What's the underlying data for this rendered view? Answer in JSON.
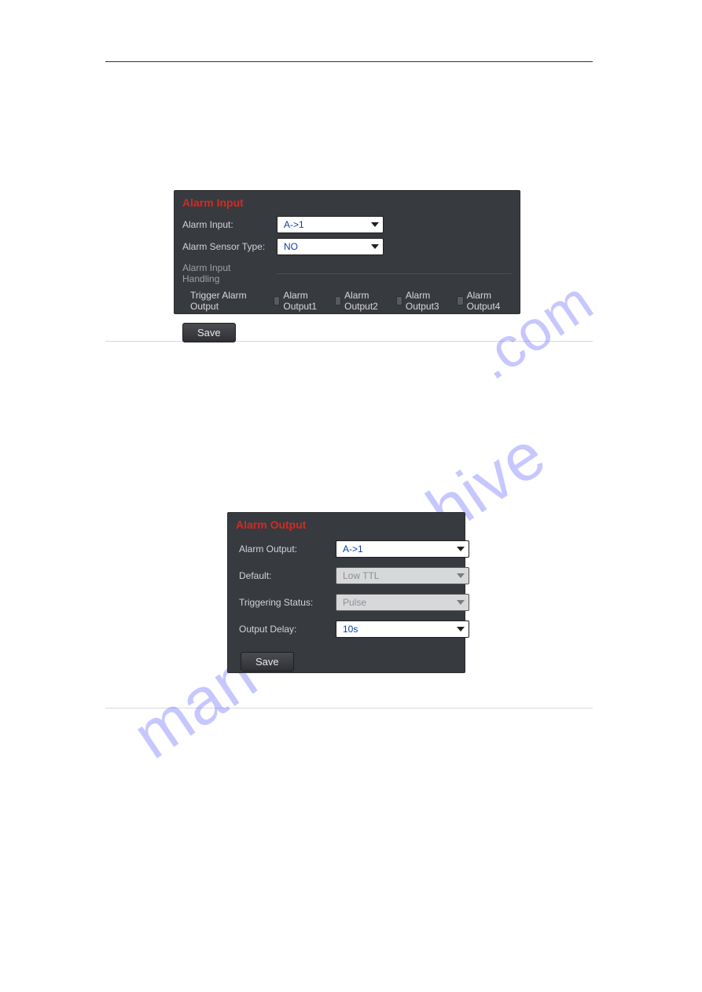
{
  "watermark": "manualshive.com",
  "panelA": {
    "title": "Alarm Input",
    "labels": {
      "alarm_input": "Alarm Input:",
      "sensor_type": "Alarm Sensor Type:",
      "handling": "Alarm Input Handling",
      "trigger": "Trigger Alarm Output"
    },
    "values": {
      "alarm_input": "A->1",
      "sensor_type": "NO"
    },
    "outputs": [
      "Alarm Output1",
      "Alarm Output2",
      "Alarm Output3",
      "Alarm Output4"
    ],
    "save": "Save"
  },
  "panelB": {
    "title": "Alarm Output",
    "labels": {
      "alarm_output": "Alarm Output:",
      "default": "Default:",
      "trig_status": "Triggering Status:",
      "output_delay": "Output Delay:"
    },
    "values": {
      "alarm_output": "A->1",
      "default": "Low TTL",
      "trig_status": "Pulse",
      "output_delay": "10s"
    },
    "save": "Save"
  }
}
